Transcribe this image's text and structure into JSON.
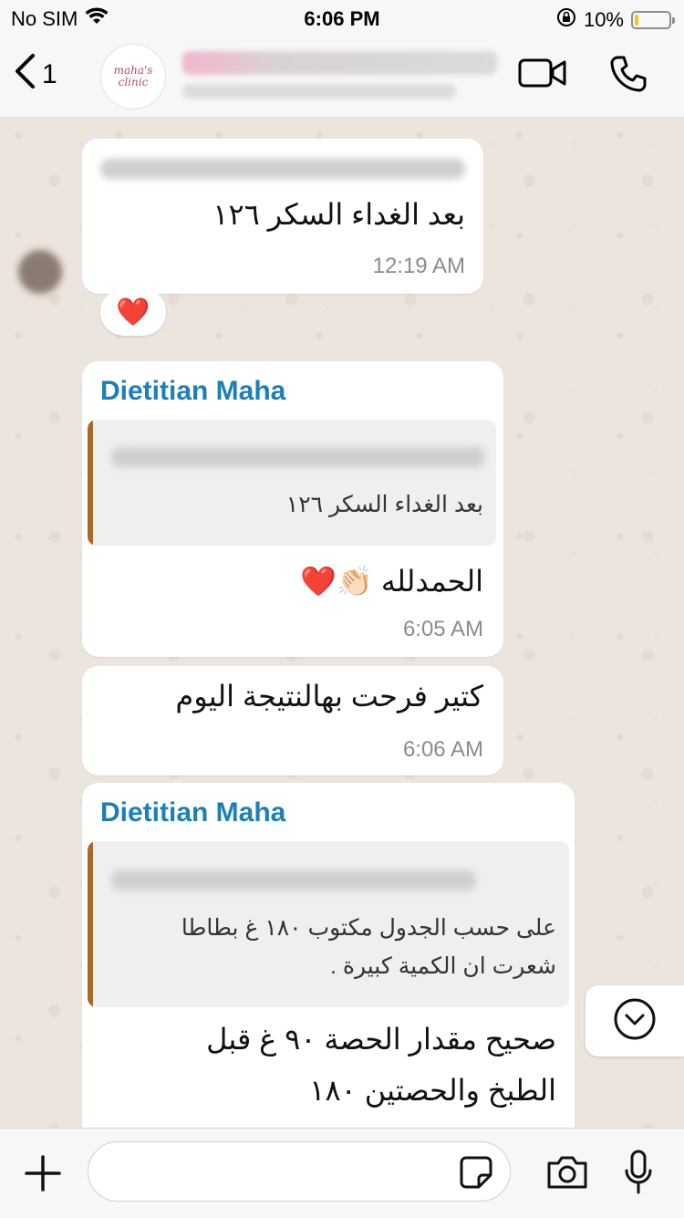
{
  "status_bar": {
    "carrier": "No SIM",
    "time": "6:06 PM",
    "battery": "10%",
    "battery_level": 0.1
  },
  "header": {
    "back_count": "1",
    "avatar_text_line1": "maha's",
    "avatar_text_line2": "clinic",
    "icons": [
      "back-chevron-icon",
      "video-call-icon",
      "phone-icon"
    ]
  },
  "messages": [
    {
      "text": "بعد الغداء السكر ١٢٦",
      "time": "12:19 AM",
      "reaction": "❤️"
    },
    {
      "sender": "Dietitian Maha",
      "quote_text": "بعد الغداء السكر ١٢٦",
      "text": "الحمدلله 👏🏻❤️",
      "time": "6:05 AM"
    },
    {
      "text": "كتير فرحت بهالنتيجة اليوم",
      "time": "6:06 AM"
    },
    {
      "sender": "Dietitian Maha",
      "quote_line1": "على حسب الجدول مكتوب ١٨٠ غ بطاطا",
      "quote_line2": "شعرت ان الكمية كبيرة .",
      "text_line1": "صحيح مقدار الحصة ٩٠ غ قبل",
      "text_line2": "الطبخ والحصتين ١٨٠"
    }
  ],
  "composer": {
    "placeholder": "",
    "icons": [
      "plus-icon",
      "sticker-icon",
      "camera-icon",
      "microphone-icon",
      "scroll-down-icon"
    ]
  },
  "colors": {
    "sender": "#1d7fb5",
    "quote_bar": "#a86a2a",
    "reaction_heart": "#e01f2b",
    "battery_fill": "#f5c518"
  }
}
